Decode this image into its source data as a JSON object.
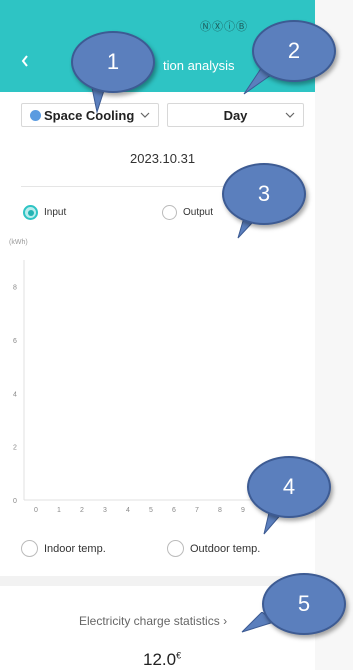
{
  "header": {
    "back_icon": "chevron-left-icon",
    "status_icons": "ⓃⓍⓘⒷ",
    "title": "tion analysis"
  },
  "selectors": {
    "mode": {
      "label": "Space Cooling",
      "dot_color": "#5b9be0"
    },
    "period": {
      "label": "Day"
    }
  },
  "date": "2023.10.31",
  "radios_top": [
    {
      "label": "Input",
      "selected": true
    },
    {
      "label": "Output",
      "selected": false
    }
  ],
  "chart_data": {
    "type": "bar",
    "ylabel": "(kWh)",
    "ylim": [
      0,
      9
    ],
    "yticks": [
      "0",
      "2",
      "4",
      "6",
      "8"
    ],
    "categories": [
      "0",
      "1",
      "2",
      "3",
      "4",
      "5",
      "6",
      "7",
      "8",
      "9"
    ],
    "values": [
      0,
      0,
      0,
      0,
      0,
      0,
      0,
      0,
      0,
      0
    ]
  },
  "radios_bottom": [
    {
      "label": "Indoor temp.",
      "selected": false
    },
    {
      "label": "Outdoor temp.",
      "selected": false
    }
  ],
  "stats": {
    "link_label": "Electricity charge statistics",
    "link_chevron": "›",
    "amount": "12.0",
    "currency": "€"
  },
  "callouts": [
    "1",
    "2",
    "3",
    "4",
    "5"
  ],
  "colors": {
    "accent": "#2ec4c4",
    "callout": "#5b7fbd"
  }
}
